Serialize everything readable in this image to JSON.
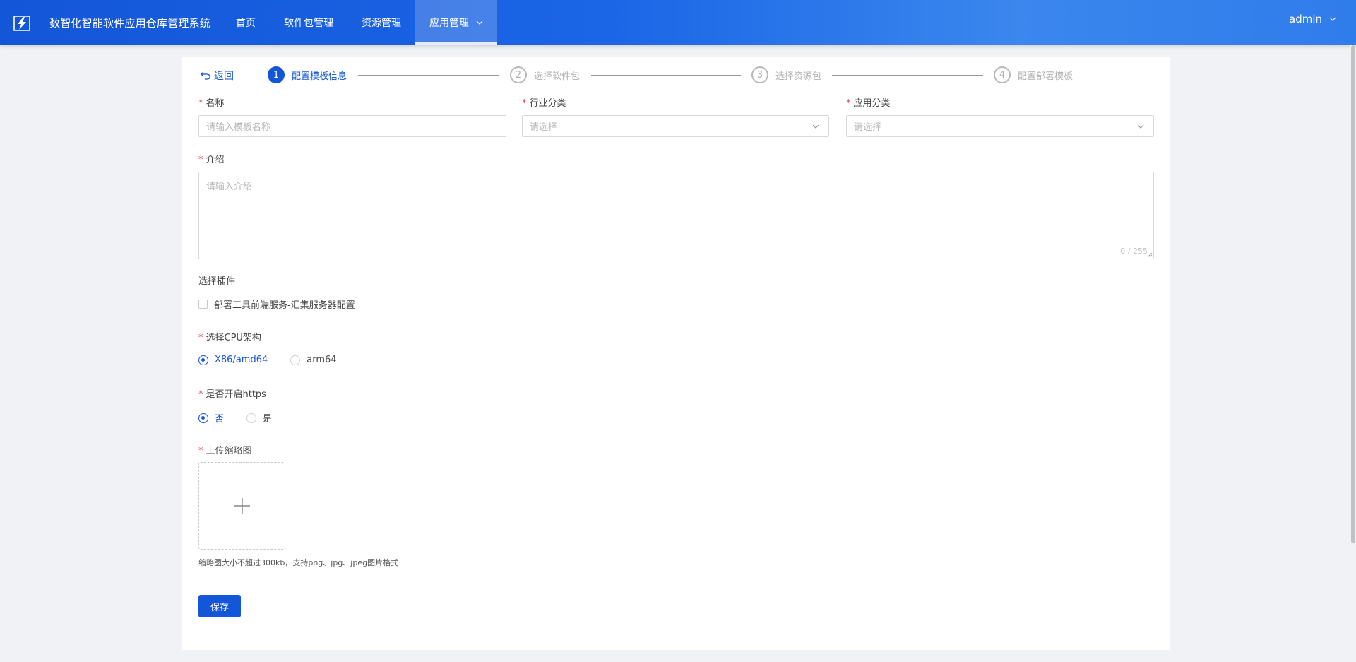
{
  "header": {
    "app_title": "数智化智能软件应用仓库管理系统",
    "nav": [
      {
        "label": "首页"
      },
      {
        "label": "软件包管理"
      },
      {
        "label": "资源管理"
      },
      {
        "label": "应用管理"
      }
    ],
    "user": "admin"
  },
  "steps": {
    "back_label": "返回",
    "items": [
      {
        "num": "1",
        "label": "配置模板信息",
        "state": "active"
      },
      {
        "num": "2",
        "label": "选择软件包",
        "state": "inactive"
      },
      {
        "num": "3",
        "label": "选择资源包",
        "state": "inactive"
      },
      {
        "num": "4",
        "label": "配置部署模板",
        "state": "inactive"
      }
    ]
  },
  "form": {
    "name": {
      "label": "名称",
      "placeholder": "请输入模板名称"
    },
    "industry": {
      "label": "行业分类",
      "placeholder": "请选择"
    },
    "app_category": {
      "label": "应用分类",
      "placeholder": "请选择"
    },
    "intro": {
      "label": "介绍",
      "placeholder": "请输入介绍",
      "counter": "0 / 255"
    },
    "plugins": {
      "label": "选择插件",
      "option": "部署工具前端服务-汇集服务器配置"
    },
    "cpu": {
      "label": "选择CPU架构",
      "options": [
        "X86/amd64",
        "arm64"
      ],
      "selected": "X86/amd64"
    },
    "https": {
      "label": "是否开启https",
      "options": [
        "否",
        "是"
      ],
      "selected": "否"
    },
    "thumbnail": {
      "label": "上传缩略图",
      "hint": "缩略图大小不超过300kb，支持png、jpg、jpeg图片格式"
    },
    "save_label": "保存"
  },
  "colors": {
    "primary": "#1456d8",
    "required": "#e5484d",
    "header_gradient_start": "#1456d8",
    "header_gradient_end": "#3b87ee"
  }
}
